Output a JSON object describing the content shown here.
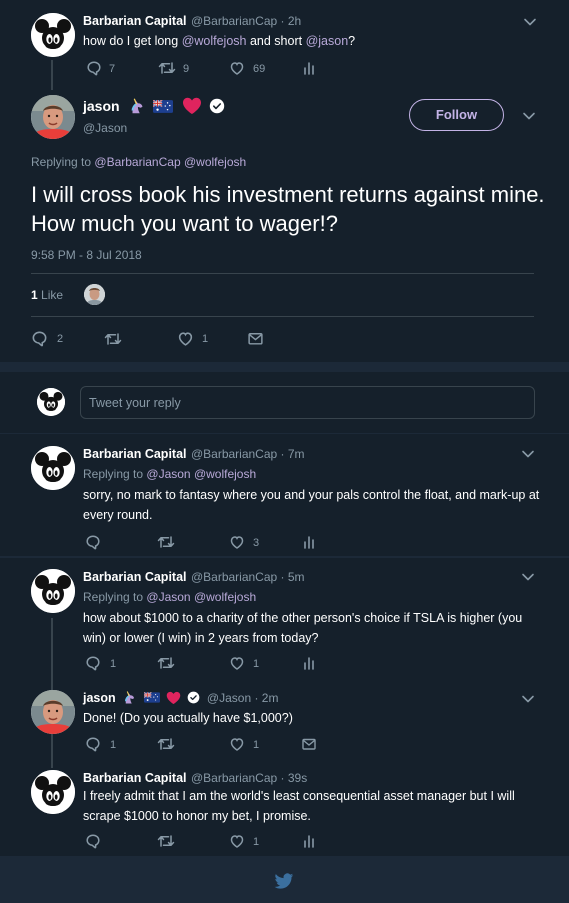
{
  "tweets": [
    {
      "name": "Barbarian Capital",
      "handle": "@BarbarianCap",
      "time": " · 2h",
      "text_pre": "how do I get long ",
      "mention1": "@wolfejosh",
      "text_mid": " and short ",
      "mention2": "@jason",
      "text_post": "?",
      "reply_count": "7",
      "retweet_count": "9",
      "like_count": "69"
    },
    {
      "name": "Barbarian Capital",
      "handle": "@BarbarianCap",
      "time": " · 7m",
      "replying_label": "Replying to",
      "replying_1": "@Jason",
      "replying_2": "@wolfejosh",
      "text": "sorry, no mark to fantasy where you and your pals control the float, and mark-up at every round.",
      "like_count": "3"
    },
    {
      "name": "Barbarian Capital",
      "handle": "@BarbarianCap",
      "time": " · 5m",
      "replying_label": "Replying to",
      "replying_1": "@Jason",
      "replying_2": "@wolfejosh",
      "text": "how about $1000 to a charity of the other person's choice if TSLA is higher (you win) or lower (I win) in 2 years from today?",
      "reply_count": "1",
      "like_count": "1"
    },
    {
      "name": "jason",
      "handle": "@Jason",
      "time": " · 2m",
      "text": "Done! (Do you actually have $1,000?)",
      "reply_count": "1",
      "like_count": "1"
    },
    {
      "name": "Barbarian Capital",
      "handle": "@BarbarianCap",
      "time": " · 39s",
      "text": "I freely admit that I am the world's least consequential asset manager but I will scrape $1000 to honor my bet, I promise.",
      "like_count": "1"
    }
  ],
  "main_tweet": {
    "name": "jason",
    "handle": "@Jason",
    "follow_label": "Follow",
    "replying_label": "Replying to",
    "replying_1": "@BarbarianCap",
    "replying_2": "@wolfejosh",
    "text": "I will cross book his investment returns against mine. How much you want to wager!?",
    "timestamp": "9:58 PM - 8 Jul 2018",
    "likes_number": "1",
    "likes_label": "Like",
    "reply_count": "2",
    "like_count": "1"
  },
  "reply_box": {
    "placeholder": "Tweet your reply"
  },
  "icons": {
    "reply": "reply-icon",
    "retweet": "retweet-icon",
    "like": "heart-icon",
    "analytics": "analytics-icon",
    "dm": "envelope-icon",
    "verified": "verified-badge-icon",
    "chevron": "chevron-down-icon",
    "footer": "twitter-bird-icon"
  },
  "colors": {
    "background": "#15202b",
    "separator": "#1c2938",
    "border": "#38444d",
    "muted": "#8899a6",
    "link": "#b8a9d8",
    "follow": "#c3b3e6",
    "heart": "#e0245e",
    "verified": "#1da1f2"
  }
}
